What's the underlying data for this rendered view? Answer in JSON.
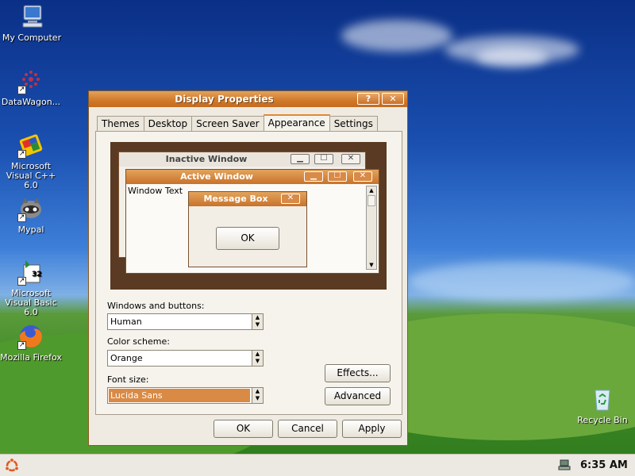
{
  "desktop_icons": [
    {
      "label": "My Computer",
      "icon": "computer-icon"
    },
    {
      "label": "DataWagon...",
      "icon": "datawagon-icon"
    },
    {
      "label": "Microsoft Visual C++ 6.0",
      "icon": "visual-cpp-icon"
    },
    {
      "label": "Mypal",
      "icon": "mypal-icon"
    },
    {
      "label": "Microsoft Visual Basic 6.0",
      "icon": "visual-basic-icon"
    },
    {
      "label": "Mozilla Firefox",
      "icon": "firefox-icon"
    },
    {
      "label": "Recycle Bin",
      "icon": "recycle-bin-icon"
    }
  ],
  "window": {
    "title": "Display Properties",
    "help_label": "?",
    "close_label": "✕",
    "tabs": [
      "Themes",
      "Desktop",
      "Screen Saver",
      "Appearance",
      "Settings"
    ],
    "active_tab": "Appearance",
    "preview": {
      "inactive_title": "Inactive Window",
      "active_title": "Active Window",
      "window_text": "Window Text",
      "message_box_title": "Message Box",
      "message_box_ok": "OK",
      "min_glyph": "▁",
      "max_glyph": "☐",
      "close_glyph": "✕"
    },
    "windows_and_buttons": {
      "label": "Windows and buttons:",
      "value": "Human"
    },
    "color_scheme": {
      "label": "Color scheme:",
      "value": "Orange"
    },
    "font_size": {
      "label": "Font size:",
      "value": "Lucida Sans"
    },
    "effects_label": "Effects...",
    "advanced_label": "Advanced",
    "ok_label": "OK",
    "cancel_label": "Cancel",
    "apply_label": "Apply"
  },
  "taskbar": {
    "start_icon": "ubuntu-logo-icon",
    "tray_icon": "network-icon",
    "clock": "6:35 AM"
  },
  "colors": {
    "accent": "#d27b2c",
    "selection": "#d98a45",
    "preview_bg": "#5a3a22"
  }
}
